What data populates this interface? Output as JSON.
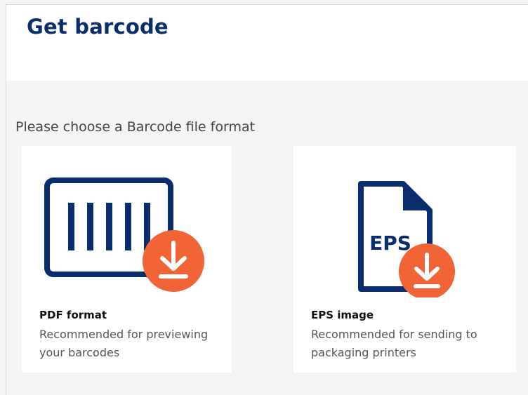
{
  "header": {
    "title": "Get barcode"
  },
  "main": {
    "prompt": "Please choose a Barcode file format",
    "options": [
      {
        "name": "PDF format",
        "description": "Recommended for previewing your barcodes",
        "icon": "barcode-download-icon"
      },
      {
        "name": "EPS image",
        "description": "Recommended for sending to packaging printers",
        "icon": "eps-file-download-icon",
        "icon_text": "EPS"
      }
    ]
  },
  "colors": {
    "primary_navy": "#0a2d6e",
    "accent_orange": "#f06436",
    "background": "#f4f4f4"
  }
}
